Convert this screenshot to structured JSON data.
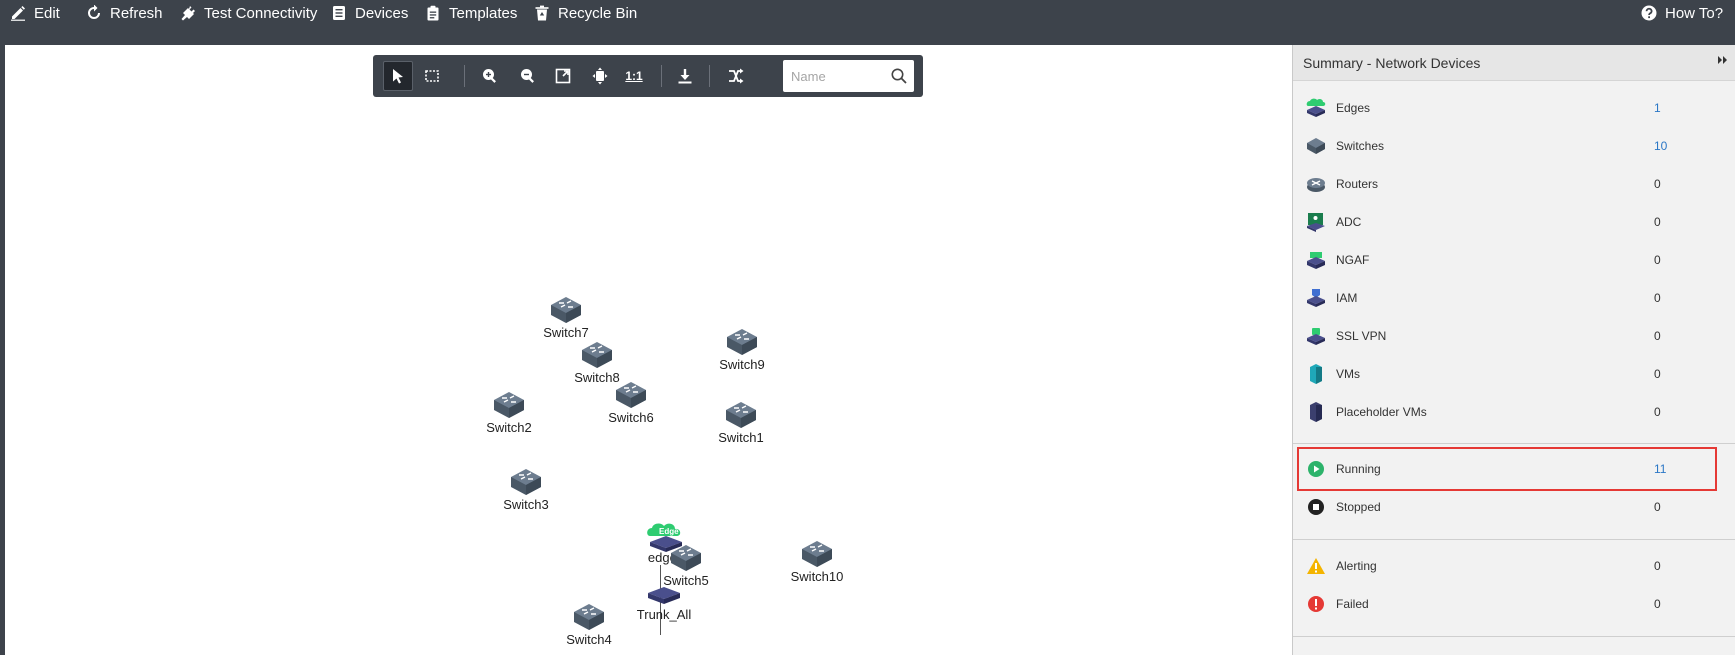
{
  "toolbar": {
    "edit": "Edit",
    "refresh": "Refresh",
    "test_connectivity": "Test Connectivity",
    "devices": "Devices",
    "templates": "Templates",
    "recycle_bin": "Recycle Bin",
    "how_to": "How To?"
  },
  "canvas_tools": {
    "one_to_one": "1:1",
    "search_placeholder": "Name"
  },
  "topology": {
    "nodes": {
      "switch7": "Switch7",
      "switch8": "Switch8",
      "switch9": "Switch9",
      "switch2": "Switch2",
      "switch6": "Switch6",
      "switch1": "Switch1",
      "switch3": "Switch3",
      "edge1": "edge1",
      "edge_badge": "Edge",
      "switch5": "Switch5",
      "switch10": "Switch10",
      "trunk_all": "Trunk_All",
      "switch4": "Switch4"
    }
  },
  "summary": {
    "title": "Summary  -  Network Devices",
    "devices": [
      {
        "label": "Edges",
        "count": "1"
      },
      {
        "label": "Switches",
        "count": "10"
      },
      {
        "label": "Routers",
        "count": "0"
      },
      {
        "label": "ADC",
        "count": "0"
      },
      {
        "label": "NGAF",
        "count": "0"
      },
      {
        "label": "IAM",
        "count": "0"
      },
      {
        "label": "SSL VPN",
        "count": "0"
      },
      {
        "label": "VMs",
        "count": "0"
      },
      {
        "label": "Placeholder VMs",
        "count": "0"
      }
    ],
    "states": [
      {
        "label": "Running",
        "count": "11"
      },
      {
        "label": "Stopped",
        "count": "0"
      }
    ],
    "alerts": [
      {
        "label": "Alerting",
        "count": "0"
      },
      {
        "label": "Failed",
        "count": "0"
      }
    ]
  },
  "colors": {
    "toolbar_bg": "#3d434b",
    "canvas_bg": "#ffffff",
    "panel_bg": "#f2f2f2",
    "link_count": "#2b77c6",
    "highlight": "#e53935",
    "switch": "#5b6b7d",
    "edge_green": "#2ecc71",
    "running_green": "#2db36b",
    "warning_yellow": "#f4b400",
    "failed_red": "#e53935"
  }
}
